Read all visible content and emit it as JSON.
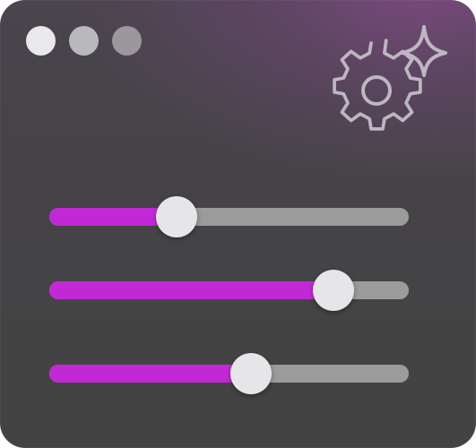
{
  "window": {
    "controls": [
      {
        "name": "close",
        "color": "#e9e9ec"
      },
      {
        "name": "minimize",
        "color": "#b9b8bd"
      },
      {
        "name": "maximize",
        "color": "#9a989d"
      }
    ]
  },
  "header": {
    "icons": [
      "gear-icon",
      "sparkle-icon"
    ]
  },
  "colors": {
    "accent": "#c229d6",
    "track": "#9b9b9b",
    "thumb": "#e6e6e8",
    "icon_stroke": "#bdb7c2"
  },
  "sliders": [
    {
      "value": 0.355
    },
    {
      "value": 0.79
    },
    {
      "value": 0.56
    }
  ]
}
